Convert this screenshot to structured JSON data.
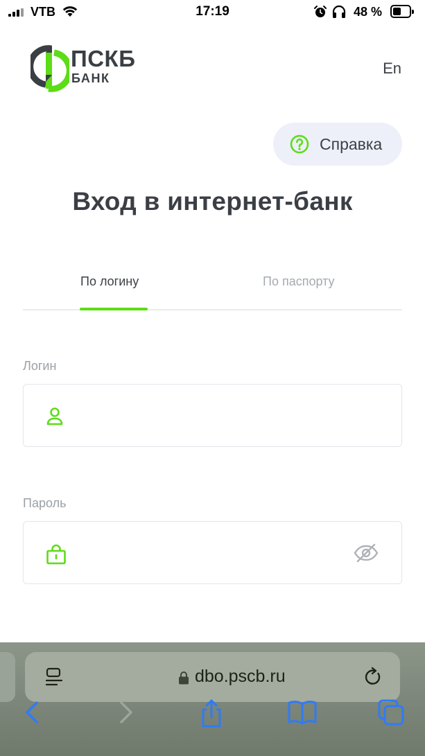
{
  "status_bar": {
    "carrier": "VTB",
    "time": "17:19",
    "battery": "48 %",
    "battery_level": 0.48
  },
  "header": {
    "logo_main": "ПСКБ",
    "logo_sub": "БАНК",
    "language_link": "En"
  },
  "help_button": {
    "label": "Справка",
    "icon": "question-circle-icon"
  },
  "page_title": "Вход в интернет-банк",
  "tabs": [
    {
      "label": "По логину",
      "active": true
    },
    {
      "label": "По паспорту",
      "active": false
    }
  ],
  "form": {
    "login": {
      "label": "Логин",
      "value": "",
      "icon": "user-icon"
    },
    "password": {
      "label": "Пароль",
      "value": "",
      "icon": "lock-icon",
      "toggle_icon": "eye-slash-icon"
    }
  },
  "browser": {
    "url": "dbo.pscb.ru",
    "buttons": [
      "back",
      "forward",
      "share",
      "bookmarks",
      "tabs"
    ]
  },
  "colors": {
    "accent": "#5ddc17",
    "text": "#3b3f45",
    "muted": "#a5a9af",
    "help_bg": "#edf0f8",
    "ios_blue": "#2f7bf6"
  }
}
